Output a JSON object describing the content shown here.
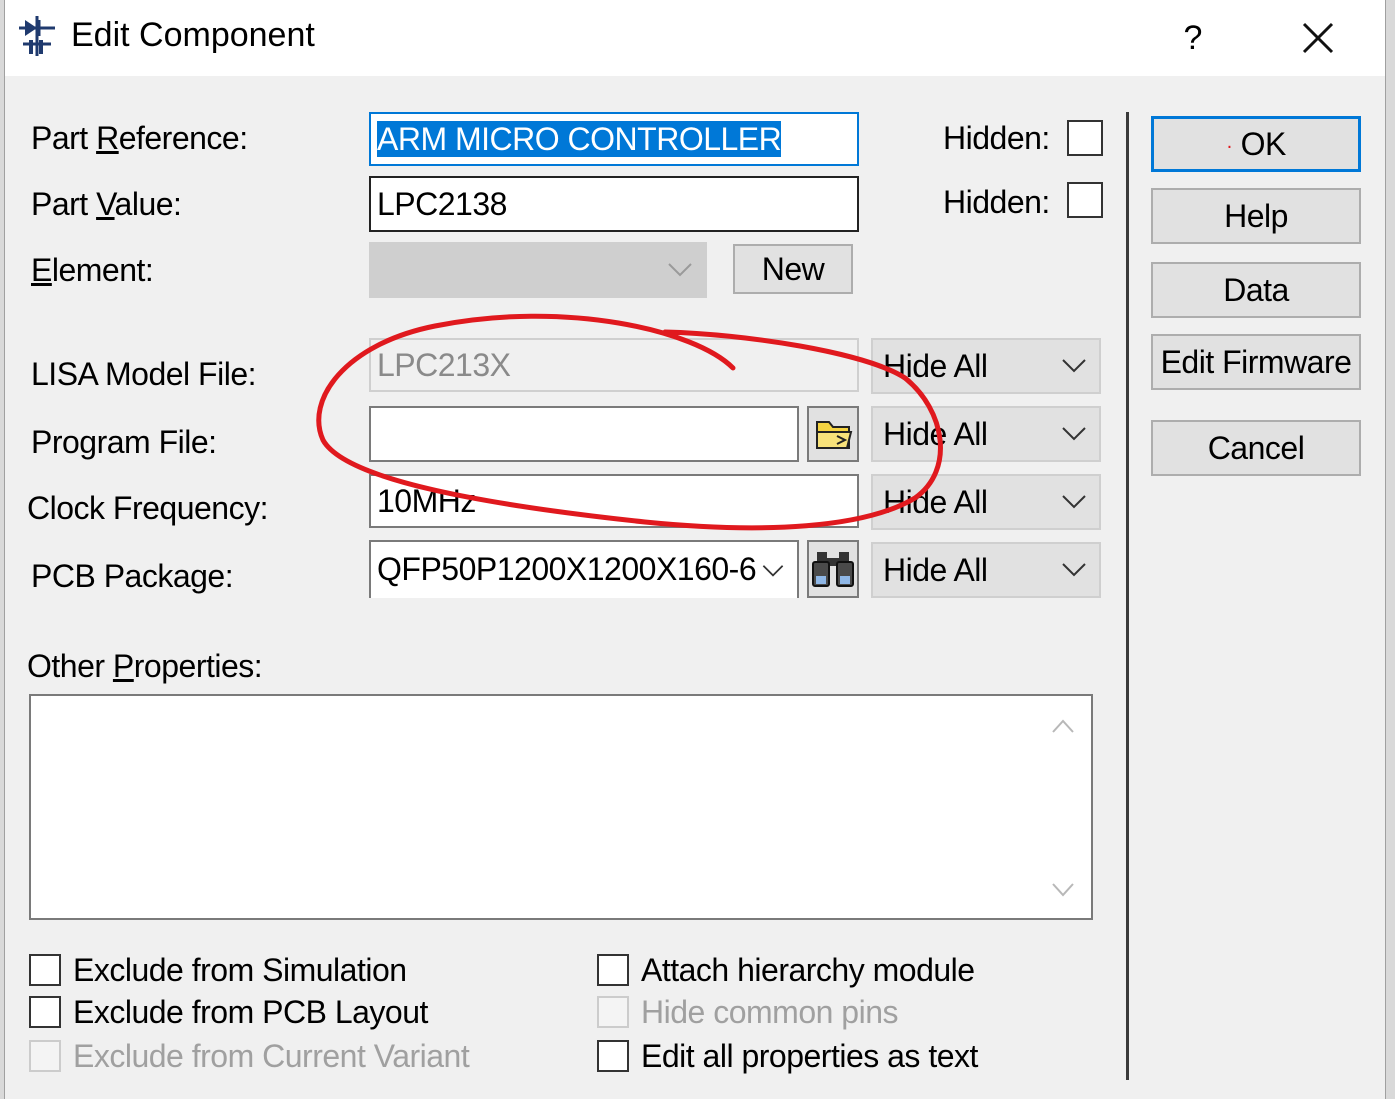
{
  "window": {
    "title": "Edit Component",
    "help_label": "?"
  },
  "fields": {
    "part_reference": {
      "label_pre": "Part ",
      "label_key": "R",
      "label_post": "eference:",
      "value": "ARM MICRO CONTROLLER",
      "hidden_label": "Hidden:"
    },
    "part_value": {
      "label_pre": "Part ",
      "label_key": "V",
      "label_post": "alue:",
      "value": "LPC2138",
      "hidden_label": "Hidden:"
    },
    "element": {
      "label_key": "E",
      "label_post": "lement:",
      "value": "",
      "new_label": "New"
    },
    "lisa_model_file": {
      "label": "LISA Model File:",
      "value": "LPC213X",
      "visibility": "Hide All"
    },
    "program_file": {
      "label": "Program File:",
      "value": "",
      "visibility": "Hide All"
    },
    "clock_frequency": {
      "label": "Clock Frequency:",
      "value": "10MHz",
      "visibility": "Hide All"
    },
    "pcb_package": {
      "label": "PCB Package:",
      "value": "QFP50P1200X1200X160-6",
      "visibility": "Hide All"
    },
    "other_properties": {
      "label_pre": "Other ",
      "label_key": "P",
      "label_post": "roperties:",
      "value": ""
    }
  },
  "buttons": {
    "ok": "OK",
    "help": "Help",
    "data": "Data",
    "edit_firmware": "Edit Firmware",
    "cancel": "Cancel"
  },
  "checkboxes": {
    "exclude_simulation": "Exclude from Simulation",
    "exclude_pcb": "Exclude from PCB Layout",
    "exclude_variant": "Exclude from Current Variant",
    "attach_hierarchy": "Attach hierarchy module",
    "hide_common_pins": "Hide common pins",
    "edit_all_text": "Edit all properties as text"
  },
  "icons": {
    "app": "component-icon",
    "close": "close-icon",
    "folder": "folder-icon",
    "search": "binoculars-icon"
  },
  "colors": {
    "accent": "#0078d7",
    "annotation": "#e0191e",
    "dialog_bg": "#f0f0f0"
  }
}
